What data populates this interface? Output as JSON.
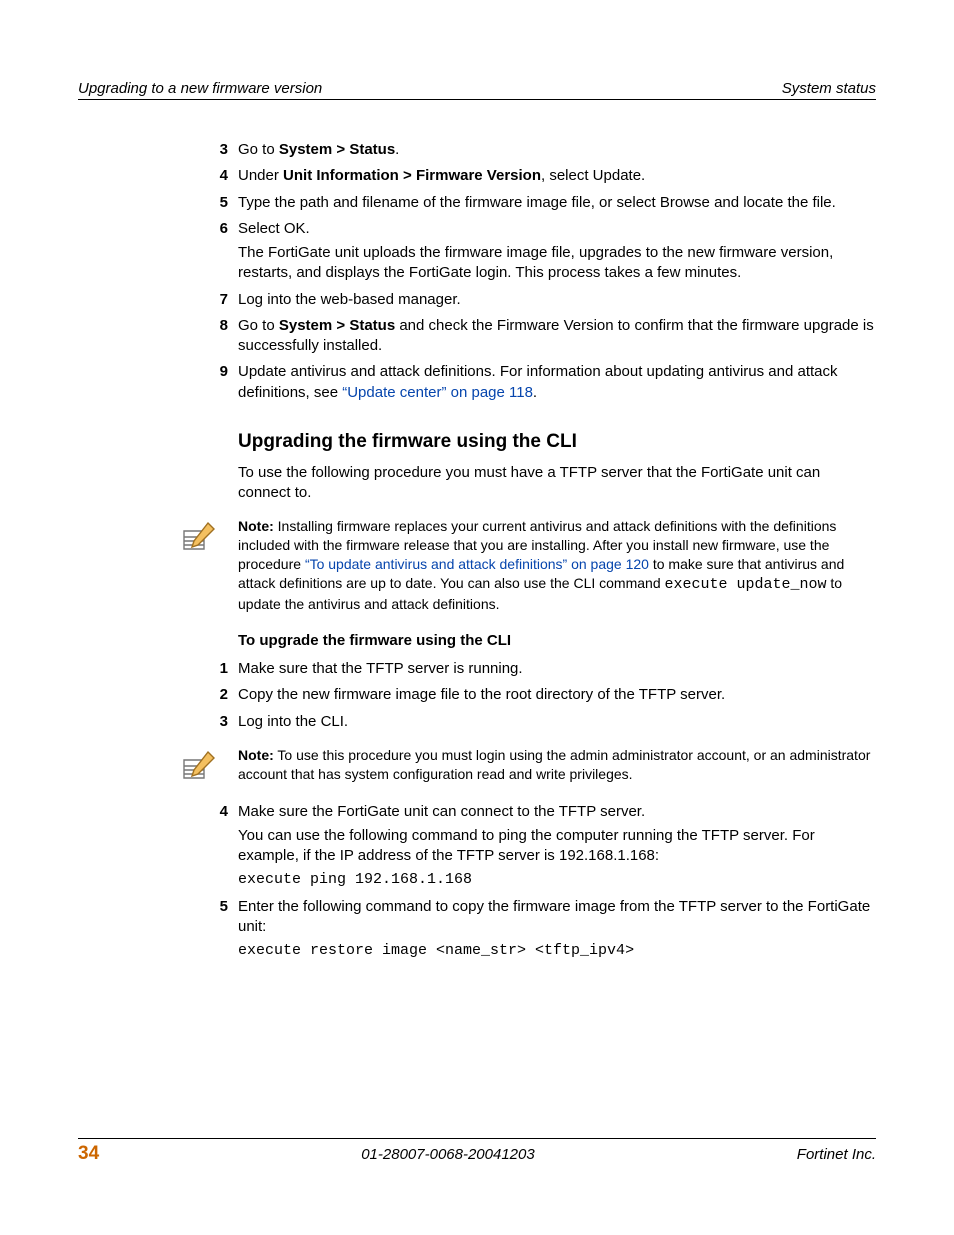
{
  "header": {
    "left": "Upgrading to a new firmware version",
    "right": "System status"
  },
  "steps_a": [
    {
      "n": "3",
      "paras": [
        {
          "runs": [
            {
              "t": "Go to "
            },
            {
              "t": "System > Status",
              "b": true
            },
            {
              "t": "."
            }
          ]
        }
      ]
    },
    {
      "n": "4",
      "paras": [
        {
          "runs": [
            {
              "t": "Under "
            },
            {
              "t": "Unit Information > Firmware Version",
              "b": true
            },
            {
              "t": ", select Update."
            }
          ]
        }
      ]
    },
    {
      "n": "5",
      "paras": [
        {
          "runs": [
            {
              "t": "Type the path and filename of the firmware image file, or select Browse and locate the file."
            }
          ]
        }
      ]
    },
    {
      "n": "6",
      "paras": [
        {
          "runs": [
            {
              "t": "Select OK."
            }
          ]
        },
        {
          "runs": [
            {
              "t": "The FortiGate unit uploads the firmware image file, upgrades to the new firmware version, restarts, and displays the FortiGate login. This process takes a few minutes."
            }
          ]
        }
      ]
    },
    {
      "n": "7",
      "paras": [
        {
          "runs": [
            {
              "t": "Log into the web-based manager."
            }
          ]
        }
      ]
    },
    {
      "n": "8",
      "paras": [
        {
          "runs": [
            {
              "t": "Go to "
            },
            {
              "t": "System > Status",
              "b": true
            },
            {
              "t": " and check the Firmware Version to confirm that the firmware upgrade is successfully installed."
            }
          ]
        }
      ]
    },
    {
      "n": "9",
      "paras": [
        {
          "runs": [
            {
              "t": "Update antivirus and attack definitions. For information about updating antivirus and attack definitions, see "
            },
            {
              "t": "“Update center” on page 118",
              "link": true
            },
            {
              "t": "."
            }
          ]
        }
      ]
    }
  ],
  "subhead": "Upgrading the firmware using the CLI",
  "intro": "To use the following procedure you must have a TFTP server that the FortiGate unit can connect to.",
  "note1": {
    "runs": [
      {
        "t": "Note:",
        "b": true
      },
      {
        "t": " Installing firmware replaces your current antivirus and attack definitions with the definitions included with the firmware release that you are installing. After you install new firmware, use the procedure "
      },
      {
        "t": "“To update antivirus and attack definitions” on page 120",
        "link": true
      },
      {
        "t": " to make sure that antivirus and attack definitions are up to date. You can also use the CLI command "
      },
      {
        "t": "execute update_now",
        "code": true
      },
      {
        "t": " to update the antivirus and attack definitions."
      }
    ]
  },
  "proc_title": "To upgrade the firmware using the CLI",
  "steps_b": [
    {
      "n": "1",
      "paras": [
        {
          "runs": [
            {
              "t": "Make sure that the TFTP server is running."
            }
          ]
        }
      ]
    },
    {
      "n": "2",
      "paras": [
        {
          "runs": [
            {
              "t": "Copy the new firmware image file to the root directory of the TFTP server."
            }
          ]
        }
      ]
    },
    {
      "n": "3",
      "paras": [
        {
          "runs": [
            {
              "t": "Log into the CLI."
            }
          ]
        }
      ]
    }
  ],
  "note2": {
    "runs": [
      {
        "t": "Note:",
        "b": true
      },
      {
        "t": " To use this procedure you must login using the admin administrator account, or an administrator account that has system configuration read and write privileges."
      }
    ]
  },
  "steps_c": [
    {
      "n": "4",
      "paras": [
        {
          "runs": [
            {
              "t": "Make sure the FortiGate unit can connect to the TFTP server."
            }
          ]
        },
        {
          "runs": [
            {
              "t": "You can use the following command to ping the computer running the TFTP server. For example, if the IP address of the TFTP server is 192.168.1.168:"
            }
          ]
        }
      ],
      "cmd": "execute ping 192.168.1.168"
    },
    {
      "n": "5",
      "paras": [
        {
          "runs": [
            {
              "t": "Enter the following command to copy the firmware image from the TFTP server to the FortiGate unit:"
            }
          ]
        }
      ],
      "cmd": "execute restore image <name_str> <tftp_ipv4>"
    }
  ],
  "footer": {
    "page": "34",
    "mid": "01-28007-0068-20041203",
    "right": "Fortinet Inc."
  }
}
